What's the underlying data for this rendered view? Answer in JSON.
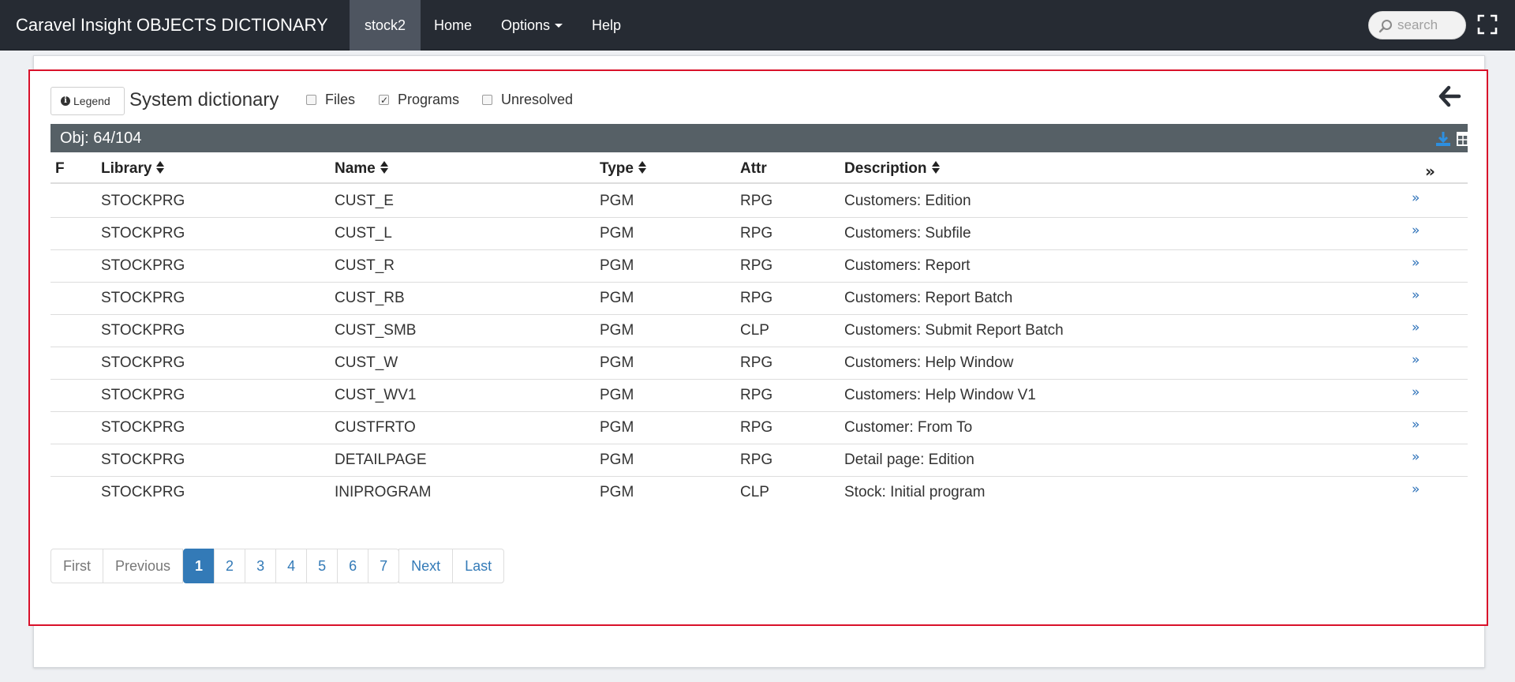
{
  "navbar": {
    "brand": "Caravel Insight OBJECTS DICTIONARY",
    "items": [
      {
        "label": "stock2",
        "active": true
      },
      {
        "label": "Home"
      },
      {
        "label": "Options"
      },
      {
        "label": "Help"
      }
    ],
    "search_placeholder": "search"
  },
  "toolbar": {
    "legend_label": "Legend",
    "title": "System dictionary",
    "filters": [
      {
        "label": "Files",
        "checked": false
      },
      {
        "label": "Programs",
        "checked": true
      },
      {
        "label": "Unresolved",
        "checked": false
      }
    ]
  },
  "summary": {
    "obj_count": "Obj: 64/104"
  },
  "table": {
    "columns": [
      "F",
      "Library",
      "Name",
      "Type",
      "Attr",
      "Description"
    ],
    "rows": [
      {
        "f": "",
        "library": "STOCKPRG",
        "name": "CUST_E",
        "type": "PGM",
        "attr": "RPG",
        "description": "Customers: Edition"
      },
      {
        "f": "",
        "library": "STOCKPRG",
        "name": "CUST_L",
        "type": "PGM",
        "attr": "RPG",
        "description": "Customers: Subfile"
      },
      {
        "f": "",
        "library": "STOCKPRG",
        "name": "CUST_R",
        "type": "PGM",
        "attr": "RPG",
        "description": "Customers: Report"
      },
      {
        "f": "",
        "library": "STOCKPRG",
        "name": "CUST_RB",
        "type": "PGM",
        "attr": "RPG",
        "description": "Customers: Report Batch"
      },
      {
        "f": "",
        "library": "STOCKPRG",
        "name": "CUST_SMB",
        "type": "PGM",
        "attr": "CLP",
        "description": "Customers: Submit Report Batch"
      },
      {
        "f": "",
        "library": "STOCKPRG",
        "name": "CUST_W",
        "type": "PGM",
        "attr": "RPG",
        "description": "Customers: Help Window"
      },
      {
        "f": "",
        "library": "STOCKPRG",
        "name": "CUST_WV1",
        "type": "PGM",
        "attr": "RPG",
        "description": "Customers: Help Window V1"
      },
      {
        "f": "",
        "library": "STOCKPRG",
        "name": "CUSTFRTO",
        "type": "PGM",
        "attr": "RPG",
        "description": "Customer: From To"
      },
      {
        "f": "",
        "library": "STOCKPRG",
        "name": "DETAILPAGE",
        "type": "PGM",
        "attr": "RPG",
        "description": "Detail page: Edition"
      },
      {
        "f": "",
        "library": "STOCKPRG",
        "name": "INIPROGRAM",
        "type": "PGM",
        "attr": "CLP",
        "description": "Stock: Initial program"
      }
    ]
  },
  "pagination": {
    "first": "First",
    "previous": "Previous",
    "pages": [
      "1",
      "2",
      "3",
      "4",
      "5",
      "6",
      "7"
    ],
    "current": "1",
    "next": "Next",
    "last": "Last"
  },
  "colors": {
    "navbar_bg": "#262b33",
    "active_tab_bg": "#4e5560",
    "selection_outline": "#d9112a",
    "obj_bar_bg": "#566066",
    "link_blue": "#337ab7"
  }
}
